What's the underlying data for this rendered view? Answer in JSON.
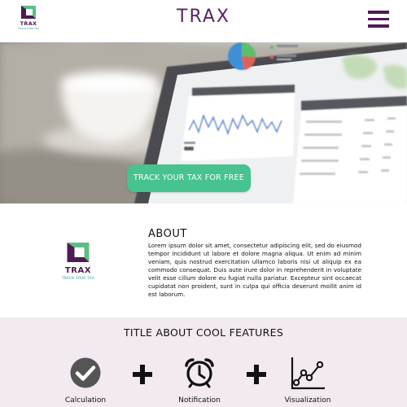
{
  "header": {
    "logo": {
      "name": "TRAX",
      "tagline": "TRACK YOUR TAX"
    },
    "title": "TRAX",
    "menu_icon": "hamburger-menu-icon"
  },
  "hero": {
    "cta_label": "TRACK YOUR TAX FOR FREE"
  },
  "about": {
    "logo": {
      "name": "TRAX",
      "tagline": "TRACK YOUR TAX"
    },
    "heading": "ABOUT",
    "body": "Lorem ipsum dolor sit amet, consectetur adipiscing elit, sed do eiusmod tempor incididunt ut labore et dolore magna aliqua. Ut enim ad minim veniam, quis nostrud exercitation ullamco laboris nisi ut aliquip ex ea commodo consequat. Duis aute irure dolor in reprehenderit in voluptate velit esse cillum dolore eu fugiat nulla pariatur. Excepteur sint occaecat cupidatat non proident, sunt in culpa qui officia deserunt mollit anim id est laborum."
  },
  "features": {
    "title": "TITLE ABOUT COOL FEATURES",
    "items": [
      {
        "label": "Calculation",
        "icon": "check-circle-icon"
      },
      {
        "label": "Notification",
        "icon": "alarm-clock-icon"
      },
      {
        "label": "Visualization",
        "icon": "line-chart-icon"
      }
    ],
    "separator_icon": "plus-icon"
  },
  "colors": {
    "brand_purple": "#4e1b55",
    "title_purple": "#5c2466",
    "brand_green": "#46c38e",
    "features_background": "#f3eaf1"
  }
}
